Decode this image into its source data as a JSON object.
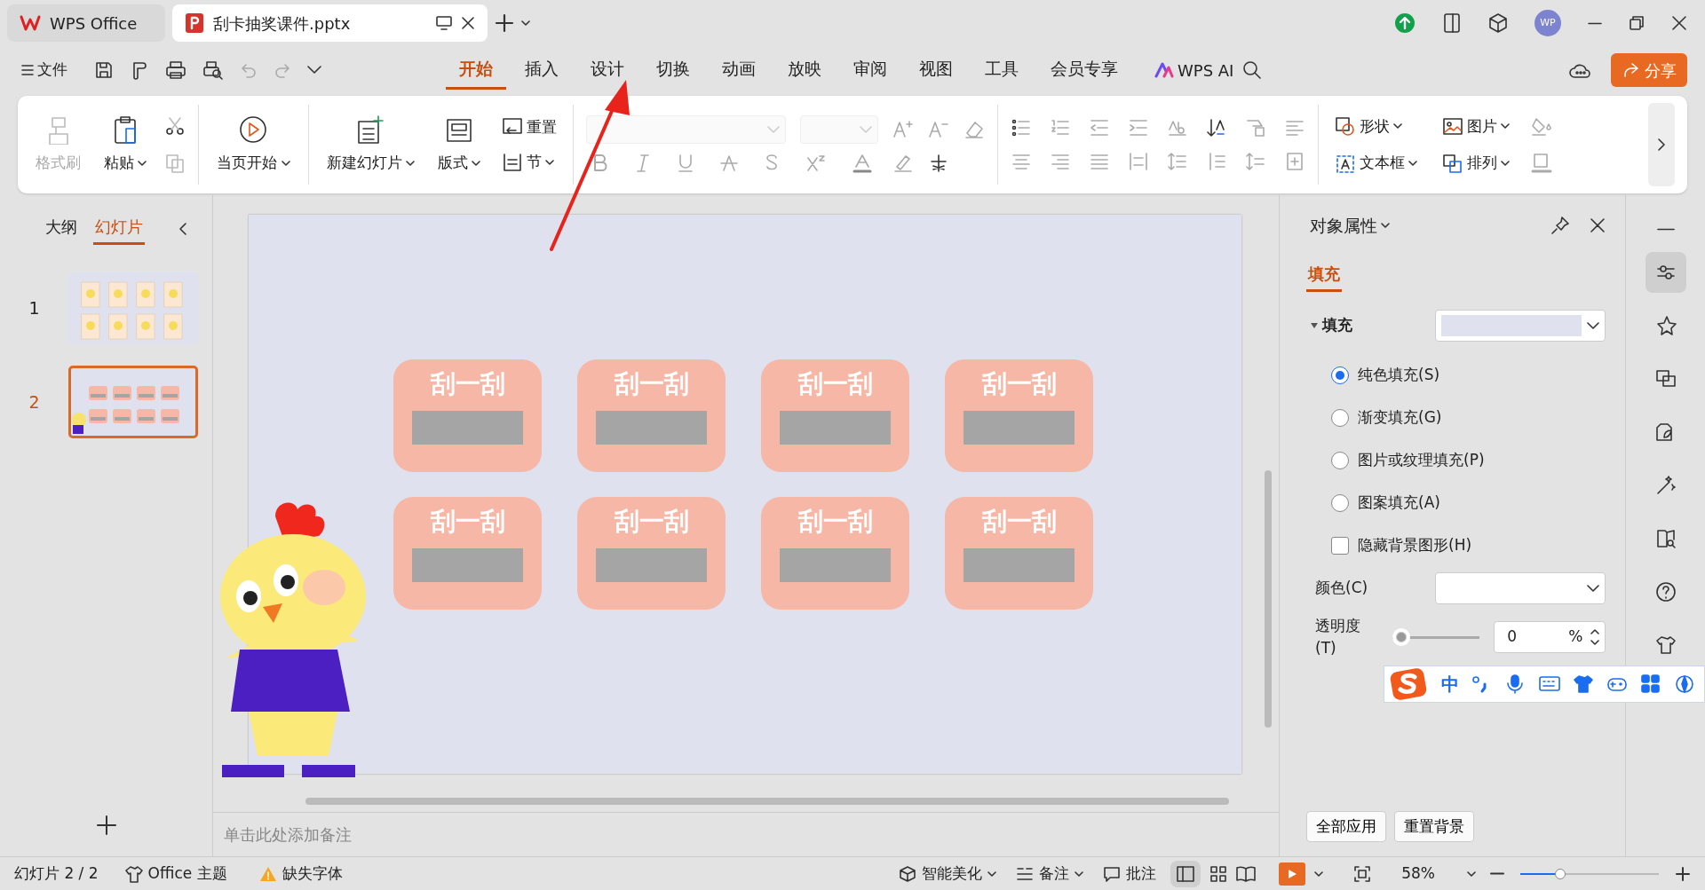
{
  "title_bar": {
    "tabs": [
      {
        "label": "WPS Office",
        "selected": false
      },
      {
        "label": "刮卡抽奖课件.pptx",
        "selected": true
      }
    ],
    "avatar": "WP"
  },
  "menu_bar": {
    "file": "文件",
    "tabs": [
      {
        "label": "开始",
        "selected": true
      },
      {
        "label": "插入",
        "selected": false
      },
      {
        "label": "设计",
        "selected": false
      },
      {
        "label": "切换",
        "selected": false
      },
      {
        "label": "动画",
        "selected": false
      },
      {
        "label": "放映",
        "selected": false
      },
      {
        "label": "审阅",
        "selected": false
      },
      {
        "label": "视图",
        "selected": false
      },
      {
        "label": "工具",
        "selected": false
      },
      {
        "label": "会员专享",
        "selected": false
      }
    ],
    "wps_ai": "WPS AI",
    "share": "分享"
  },
  "ribbon": {
    "large_buttons": [
      {
        "label": "格式刷",
        "dropdown": false,
        "disabled": true
      },
      {
        "label": "粘贴",
        "dropdown": true,
        "disabled": false
      },
      {
        "label": "当页开始",
        "dropdown": true,
        "disabled": false
      },
      {
        "label": "新建幻灯片",
        "dropdown": true,
        "disabled": false
      },
      {
        "label": "版式",
        "dropdown": true,
        "disabled": false
      }
    ],
    "small_buttons": [
      {
        "label": "重置",
        "dropdown": false
      },
      {
        "label": "节",
        "dropdown": true
      }
    ],
    "insert_buttons": [
      {
        "label": "形状",
        "dropdown": true
      },
      {
        "label": "图片",
        "dropdown": true
      },
      {
        "label": "文本框",
        "dropdown": true
      },
      {
        "label": "排列",
        "dropdown": true
      }
    ]
  },
  "slide_panel": {
    "tabs": [
      {
        "label": "大纲",
        "selected": false
      },
      {
        "label": "幻灯片",
        "selected": true
      }
    ],
    "slides": [
      {
        "number": "1",
        "selected": false
      },
      {
        "number": "2",
        "selected": true
      }
    ]
  },
  "slide": {
    "cards": [
      {
        "label": "刮一刮"
      },
      {
        "label": "刮一刮"
      },
      {
        "label": "刮一刮"
      },
      {
        "label": "刮一刮"
      },
      {
        "label": "刮一刮"
      },
      {
        "label": "刮一刮"
      },
      {
        "label": "刮一刮"
      },
      {
        "label": "刮一刮"
      }
    ]
  },
  "notes": {
    "prompt": "单击此处添加备注"
  },
  "properties": {
    "title": "对象属性",
    "tabs": [
      {
        "label": "填充",
        "selected": true
      }
    ],
    "section": {
      "label": "填充",
      "expanded": true
    },
    "fill_options": [
      {
        "label": "纯色填充(S)",
        "selected": true
      },
      {
        "label": "渐变填充(G)",
        "selected": false
      },
      {
        "label": "图片或纹理填充(P)",
        "selected": false
      },
      {
        "label": "图案填充(A)",
        "selected": false
      }
    ],
    "hide_background": {
      "label": "隐藏背景图形(H)",
      "checked": false
    },
    "color_label": "颜色(C)",
    "transparency": {
      "label": "透明度(T)",
      "level": 0,
      "value": "0",
      "unit": "%"
    },
    "buttons": [
      "全部应用",
      "重置背景"
    ]
  },
  "ime_bar": {
    "mode": "中"
  },
  "status_bar": {
    "slide": "幻灯片 2 / 2",
    "theme": "Office 主题",
    "missing_fonts": "缺失字体",
    "beautify": "智能美化",
    "notes": "备注",
    "comments": "批注",
    "zoom": "58%",
    "zoom_slider": {
      "level": 0.27
    }
  }
}
